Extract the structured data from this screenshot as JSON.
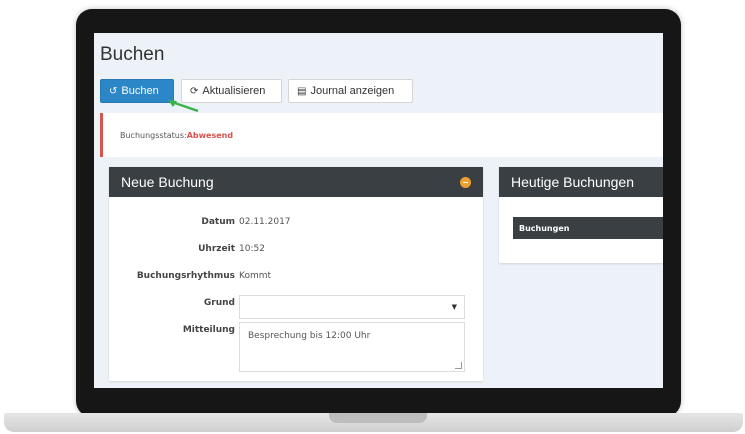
{
  "page": {
    "title": "Buchen"
  },
  "toolbar": {
    "buchen_label": "Buchen",
    "aktualisieren_label": "Aktualisieren",
    "journal_label": "Journal anzeigen"
  },
  "status": {
    "label": "Buchungsstatus:",
    "value": "Abwesend"
  },
  "neue_buchung": {
    "title": "Neue Buchung",
    "fields": {
      "datum_label": "Datum",
      "datum_value": "02.11.2017",
      "uhrzeit_label": "Uhrzeit",
      "uhrzeit_value": "10:52",
      "rhythmus_label": "Buchungsrhythmus",
      "rhythmus_value": "Kommt",
      "grund_label": "Grund",
      "grund_value": "",
      "mitteilung_label": "Mitteilung",
      "mitteilung_value": "Besprechung bis 12:00 Uhr"
    }
  },
  "heutige": {
    "title": "Heutige Buchungen",
    "table_header": "Buchungen"
  },
  "colors": {
    "primary": "#2b87c8",
    "danger": "#d9534f",
    "panel_head": "#3a3f44",
    "accent": "#f0a030"
  }
}
